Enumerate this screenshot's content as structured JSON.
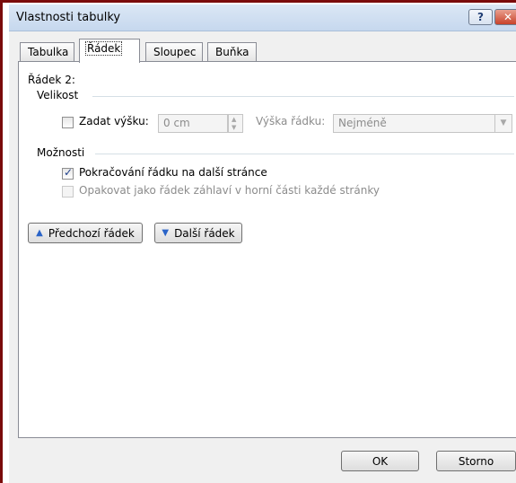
{
  "window": {
    "title": "Vlastnosti tabulky",
    "help_label": "?",
    "close_label": "✕"
  },
  "tabs": [
    {
      "label": "Tabulka"
    },
    {
      "label": "Řádek"
    },
    {
      "label": "Sloupec"
    },
    {
      "label": "Buňka"
    }
  ],
  "row_heading": "Řádek 2:",
  "size": {
    "group_label": "Velikost",
    "specify_height": {
      "label": "Zadat výšku:",
      "checked": false
    },
    "height_value": "0 cm",
    "row_height_label": "Výška řádku:",
    "row_height_option": "Nejméně"
  },
  "options": {
    "group_label": "Možnosti",
    "allow_break": {
      "label": "Pokračování řádku na další stránce",
      "checked": true
    },
    "repeat_header": {
      "label": "Opakovat jako řádek záhlaví v horní části každé stránky",
      "checked": false,
      "disabled": true
    }
  },
  "nav": {
    "previous": "Předchozí řádek",
    "next": "Další řádek"
  },
  "footer": {
    "ok": "OK",
    "cancel": "Storno"
  }
}
